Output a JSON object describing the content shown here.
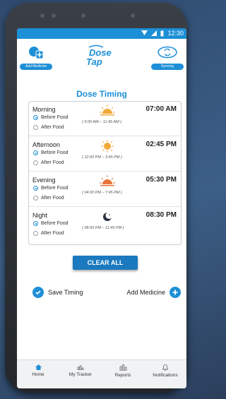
{
  "status_bar": {
    "time": "12:30"
  },
  "header": {
    "add_medicine_label": "Add Medicine",
    "logo_line1": "Dose",
    "logo_line2": "Tap",
    "syncing_label": "Syncing"
  },
  "page_title": "Dose Timing",
  "rows": [
    {
      "name": "Morning",
      "time": "07:00 AM",
      "range": "( 5:00 AM – 11:45 AM )",
      "before": "Before Food",
      "after": "After Food",
      "selected": "before",
      "icon": "sunrise-icon"
    },
    {
      "name": "Afternoon",
      "time": "02:45 PM",
      "range": "( 12:00 PM – 3:45 PM )",
      "before": "Before Food",
      "after": "After Food",
      "selected": "before",
      "icon": "sun-icon"
    },
    {
      "name": "Evening",
      "time": "05:30 PM",
      "range": "( 04:00 PM – 7:45 PM )",
      "before": "Before Food",
      "after": "After Food",
      "selected": "before",
      "icon": "sunset-icon"
    },
    {
      "name": "Night",
      "time": "08:30 PM",
      "range": "( 08:00 PM – 11:45 PM )",
      "before": "Before Food",
      "after": "After Food",
      "selected": "before",
      "icon": "moon-icon"
    }
  ],
  "clear_all_label": "CLEAR ALL",
  "save_timing_label": "Save Timing",
  "add_medicine_footer_label": "Add Medicine",
  "tabs": [
    {
      "label": "Home",
      "icon": "home-icon"
    },
    {
      "label": "My Tracker",
      "icon": "tracker-icon"
    },
    {
      "label": "Reports",
      "icon": "reports-icon"
    },
    {
      "label": "Notifications",
      "icon": "bell-icon"
    }
  ],
  "colors": {
    "accent": "#1d8fd6",
    "button": "#1a79bf",
    "sun": "#f2a93b"
  }
}
